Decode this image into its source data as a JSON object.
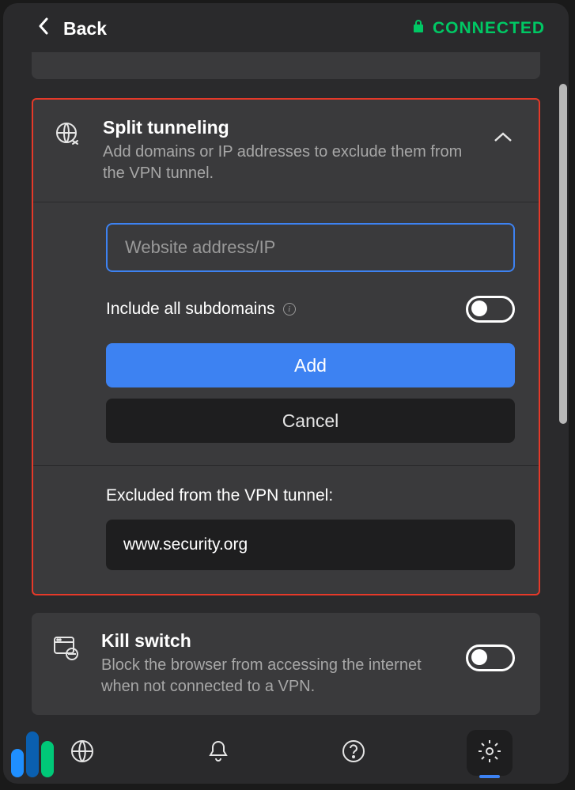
{
  "header": {
    "back_label": "Back",
    "status_label": "CONNECTED"
  },
  "split_tunneling": {
    "title": "Split tunneling",
    "subtitle": "Add domains or IP addresses to exclude them from the VPN tunnel.",
    "input_placeholder": "Website address/IP",
    "include_subdomains_label": "Include all subdomains",
    "add_label": "Add",
    "cancel_label": "Cancel",
    "excluded_title": "Excluded from the VPN tunnel:",
    "excluded_items": [
      {
        "domain": "www.security.org"
      }
    ]
  },
  "kill_switch": {
    "title": "Kill switch",
    "subtitle": "Block the browser from accessing the internet when not connected to a VPN."
  }
}
